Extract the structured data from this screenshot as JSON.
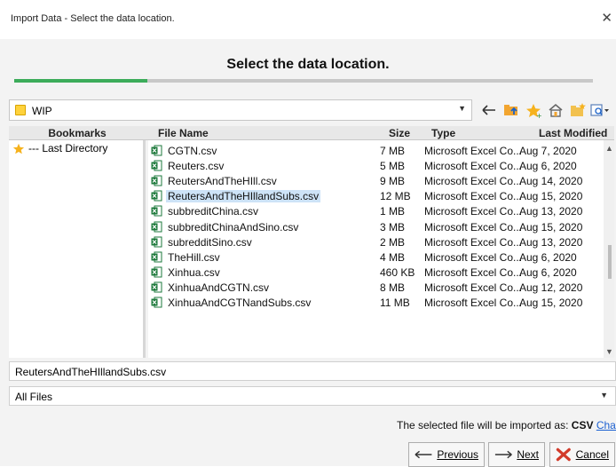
{
  "window": {
    "title": "Import Data - Select the data location.",
    "close_label": "✕"
  },
  "banner": {
    "heading": "Select the data location.",
    "progress_fraction": 0.23
  },
  "location": {
    "current_folder": "WIP"
  },
  "toolbar": {
    "icons": [
      "back-arrow-icon",
      "folder-up-icon",
      "favorite-star-icon",
      "home-icon",
      "new-folder-icon",
      "view-options-icon"
    ]
  },
  "bookmarks": {
    "header": "Bookmarks",
    "items": [
      {
        "label": "--- Last Directory"
      }
    ]
  },
  "file_table": {
    "columns": [
      "File Name",
      "Size",
      "Type",
      "Last Modified"
    ],
    "rows": [
      {
        "name": "CGTN.csv",
        "size": "7 MB",
        "type": "Microsoft Excel Co...",
        "modified": "Aug 7, 2020"
      },
      {
        "name": "Reuters.csv",
        "size": "5 MB",
        "type": "Microsoft Excel Co...",
        "modified": "Aug 6, 2020"
      },
      {
        "name": "ReutersAndTheHIll.csv",
        "size": "9 MB",
        "type": "Microsoft Excel Co...",
        "modified": "Aug 14, 2020"
      },
      {
        "name": "ReutersAndTheHIllandSubs.csv",
        "size": "12 MB",
        "type": "Microsoft Excel Co...",
        "modified": "Aug 15, 2020"
      },
      {
        "name": "subbreditChina.csv",
        "size": "1 MB",
        "type": "Microsoft Excel Co...",
        "modified": "Aug 13, 2020"
      },
      {
        "name": "subbreditChinaAndSino.csv",
        "size": "3 MB",
        "type": "Microsoft Excel Co...",
        "modified": "Aug 15, 2020"
      },
      {
        "name": "subredditSino.csv",
        "size": "2 MB",
        "type": "Microsoft Excel Co...",
        "modified": "Aug 13, 2020"
      },
      {
        "name": "TheHill.csv",
        "size": "4 MB",
        "type": "Microsoft Excel Co...",
        "modified": "Aug 6, 2020"
      },
      {
        "name": "Xinhua.csv",
        "size": "460 KB",
        "type": "Microsoft Excel Co...",
        "modified": "Aug 6, 2020"
      },
      {
        "name": "XinhuaAndCGTN.csv",
        "size": "8 MB",
        "type": "Microsoft Excel Co...",
        "modified": "Aug 12, 2020"
      },
      {
        "name": "XinhuaAndCGTNandSubs.csv",
        "size": "11 MB",
        "type": "Microsoft Excel Co...",
        "modified": "Aug 15, 2020"
      }
    ],
    "selected_index": 3
  },
  "filename_field": {
    "value": "ReutersAndTheHIllandSubs.csv"
  },
  "filter": {
    "value": "All Files"
  },
  "import_note": {
    "prefix": "The selected file will be imported as:",
    "format": "CSV",
    "change_link": "Change"
  },
  "buttons": {
    "previous": "Previous",
    "next": "Next",
    "cancel": "Cancel"
  },
  "colors": {
    "progress": "#3cac5a",
    "selection": "#cde3f7",
    "link": "#1a5fd1",
    "excel_green": "#1e7a3c",
    "cancel_red": "#d23a2a"
  }
}
